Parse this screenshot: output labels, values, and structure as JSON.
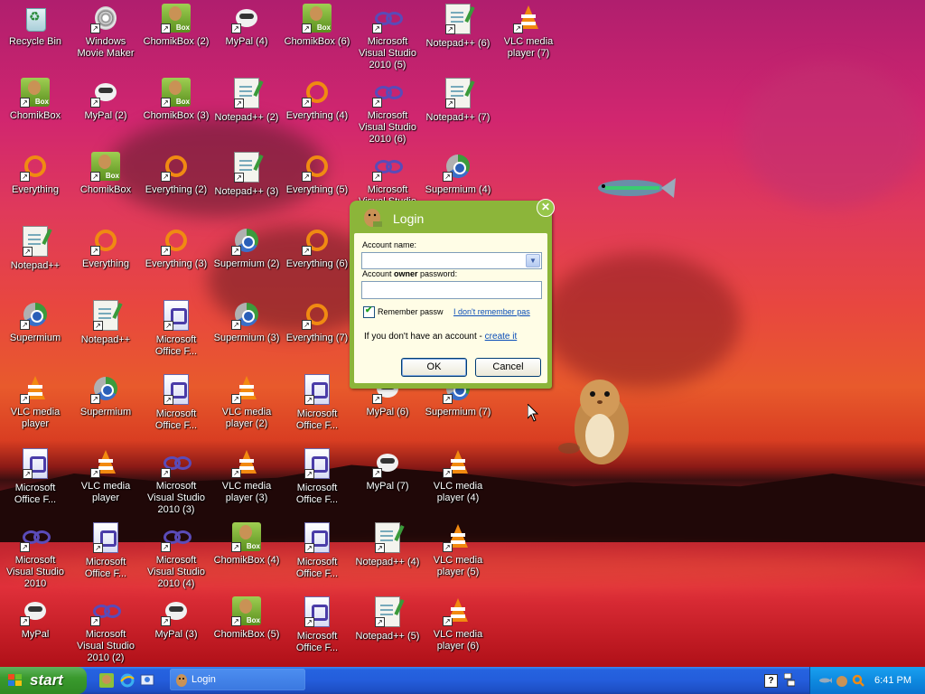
{
  "desktop": {
    "icons": [
      {
        "label": "Recycle Bin",
        "type": "recycle"
      },
      {
        "label": "Windows Movie Maker",
        "type": "moviemaker"
      },
      {
        "label": "ChomikBox (2)",
        "type": "chomik"
      },
      {
        "label": "MyPal (4)",
        "type": "mypal"
      },
      {
        "label": "ChomikBox (6)",
        "type": "chomik"
      },
      {
        "label": "Microsoft Visual Studio 2010 (5)",
        "type": "vs"
      },
      {
        "label": "Notepad++ (6)",
        "type": "notepad"
      },
      {
        "label": "VLC media player (7)",
        "type": "vlc"
      },
      {
        "label": "ChomikBox",
        "type": "chomik"
      },
      {
        "label": "MyPal (2)",
        "type": "mypal"
      },
      {
        "label": "ChomikBox (3)",
        "type": "chomik"
      },
      {
        "label": "Notepad++ (2)",
        "type": "notepad"
      },
      {
        "label": "Everything (4)",
        "type": "everything"
      },
      {
        "label": "Microsoft Visual Studio 2010 (6)",
        "type": "vs"
      },
      {
        "label": "Notepad++ (7)",
        "type": "notepad"
      },
      {
        "label": "Everything",
        "type": "everything"
      },
      {
        "label": "ChomikBox",
        "type": "chomik"
      },
      {
        "label": "Everything (2)",
        "type": "everything"
      },
      {
        "label": "Notepad++ (3)",
        "type": "notepad"
      },
      {
        "label": "Everything (5)",
        "type": "everything"
      },
      {
        "label": "Microsoft Visual Studio 2010 (7)",
        "type": "vs"
      },
      {
        "label": "Supermium (4)",
        "type": "supermium"
      },
      {
        "label": "Notepad++",
        "type": "notepad"
      },
      {
        "label": "Everything",
        "type": "everything"
      },
      {
        "label": "Everything (3)",
        "type": "everything"
      },
      {
        "label": "Supermium (2)",
        "type": "supermium"
      },
      {
        "label": "Everything (6)",
        "type": "everything"
      },
      {
        "label": "Supermium",
        "type": "supermium"
      },
      {
        "label": "Notepad++",
        "type": "notepad"
      },
      {
        "label": "Microsoft Office F...",
        "type": "office"
      },
      {
        "label": "Supermium (3)",
        "type": "supermium"
      },
      {
        "label": "Everything (7)",
        "type": "everything"
      },
      {
        "label": "VLC media player",
        "type": "vlc"
      },
      {
        "label": "Supermium",
        "type": "supermium"
      },
      {
        "label": "Microsoft Office F...",
        "type": "office"
      },
      {
        "label": "VLC media player (2)",
        "type": "vlc"
      },
      {
        "label": "Microsoft Office F...",
        "type": "office"
      },
      {
        "label": "MyPal (6)",
        "type": "mypal"
      },
      {
        "label": "Supermium (7)",
        "type": "supermium"
      },
      {
        "label": "Microsoft Office F...",
        "type": "office"
      },
      {
        "label": "VLC media player",
        "type": "vlc"
      },
      {
        "label": "Microsoft Visual Studio 2010 (3)",
        "type": "vs"
      },
      {
        "label": "VLC media player (3)",
        "type": "vlc"
      },
      {
        "label": "Microsoft Office F...",
        "type": "office"
      },
      {
        "label": "MyPal (7)",
        "type": "mypal"
      },
      {
        "label": "VLC media player (4)",
        "type": "vlc"
      },
      {
        "label": "Microsoft Visual Studio 2010",
        "type": "vs"
      },
      {
        "label": "Microsoft Office F...",
        "type": "office"
      },
      {
        "label": "Microsoft Visual Studio 2010 (4)",
        "type": "vs"
      },
      {
        "label": "ChomikBox (4)",
        "type": "chomik"
      },
      {
        "label": "Microsoft Office F...",
        "type": "office"
      },
      {
        "label": "Notepad++ (4)",
        "type": "notepad"
      },
      {
        "label": "VLC media player (5)",
        "type": "vlc"
      },
      {
        "label": "MyPal",
        "type": "mypal"
      },
      {
        "label": "Microsoft Visual Studio 2010 (2)",
        "type": "vs"
      },
      {
        "label": "MyPal (3)",
        "type": "mypal"
      },
      {
        "label": "ChomikBox (5)",
        "type": "chomik"
      },
      {
        "label": "Microsoft Office F...",
        "type": "office"
      },
      {
        "label": "Notepad++ (5)",
        "type": "notepad"
      },
      {
        "label": "VLC media player (6)",
        "type": "vlc"
      }
    ]
  },
  "login_dialog": {
    "title": "Login",
    "account_name_label": "Account name:",
    "password_label_pre": "Account ",
    "password_label_bold": "owner",
    "password_label_post": " password:",
    "account_name_value": "",
    "password_value": "",
    "remember_label": "Remember passw",
    "remember_checked": true,
    "forgot_link": "I don't remember pas",
    "no_account_text": "If you don't have an account - ",
    "create_link": "create it",
    "ok_label": "OK",
    "cancel_label": "Cancel",
    "accent_color": "#8cb53a"
  },
  "taskbar": {
    "start_label": "start",
    "window_buttons": [
      {
        "label": "Login"
      }
    ],
    "clock": "6:41 PM"
  }
}
